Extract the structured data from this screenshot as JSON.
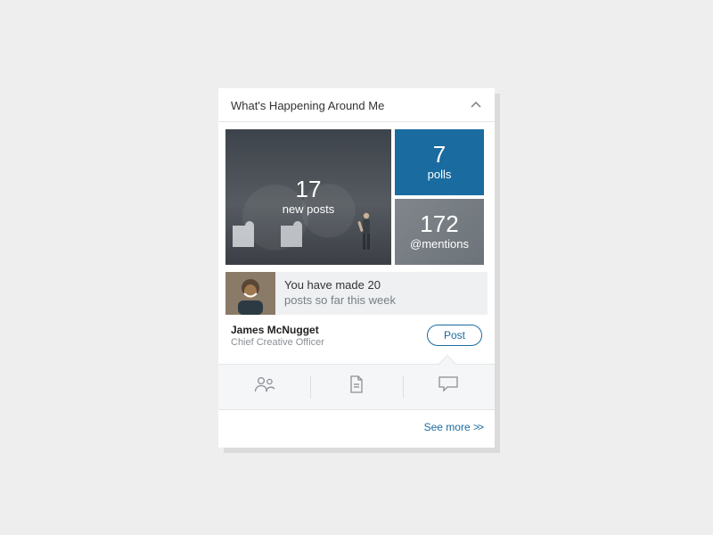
{
  "header": {
    "title": "What's Happening Around Me"
  },
  "tiles": {
    "posts": {
      "count": "17",
      "label": "new posts"
    },
    "polls": {
      "count": "7",
      "label": "polls"
    },
    "mentions": {
      "count": "172",
      "label": "@mentions"
    }
  },
  "summary": {
    "line1": "You have made 20",
    "line2": "posts so far this week"
  },
  "author": {
    "name": "James McNugget",
    "title": "Chief Creative Officer"
  },
  "actions": {
    "post": "Post",
    "see_more": "See more"
  },
  "icons": {
    "chevron": "chevron-up-icon",
    "people": "people-icon",
    "document": "document-icon",
    "chat": "chat-icon"
  },
  "colors": {
    "accent": "#1a6ca0"
  }
}
